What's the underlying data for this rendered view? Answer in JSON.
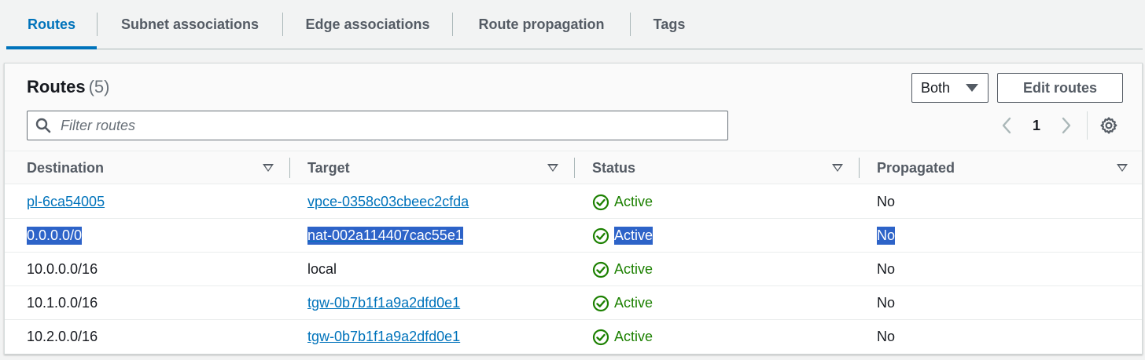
{
  "tabs": [
    {
      "label": "Routes",
      "active": true
    },
    {
      "label": "Subnet associations",
      "active": false
    },
    {
      "label": "Edge associations",
      "active": false
    },
    {
      "label": "Route propagation",
      "active": false
    },
    {
      "label": "Tags",
      "active": false
    }
  ],
  "panel": {
    "title": "Routes",
    "count": "(5)",
    "filter_select": "Both",
    "edit_button": "Edit routes",
    "search_placeholder": "Filter routes",
    "page_number": "1"
  },
  "table": {
    "columns": [
      "Destination",
      "Target",
      "Status",
      "Propagated"
    ],
    "rows": [
      {
        "destination": "pl-6ca54005",
        "destination_link": true,
        "target": "vpce-0358c03cbeec2cfda",
        "target_link": true,
        "status": "Active",
        "propagated": "No",
        "selected": false
      },
      {
        "destination": "0.0.0.0/0",
        "destination_link": false,
        "target": "nat-002a114407cac55e1",
        "target_link": true,
        "status": "Active",
        "propagated": "No",
        "selected": true
      },
      {
        "destination": "10.0.0.0/16",
        "destination_link": false,
        "target": "local",
        "target_link": false,
        "status": "Active",
        "propagated": "No",
        "selected": false
      },
      {
        "destination": "10.1.0.0/16",
        "destination_link": false,
        "target": "tgw-0b7b1f1a9a2dfd0e1",
        "target_link": true,
        "status": "Active",
        "propagated": "No",
        "selected": false
      },
      {
        "destination": "10.2.0.0/16",
        "destination_link": false,
        "target": "tgw-0b7b1f1a9a2dfd0e1",
        "target_link": true,
        "status": "Active",
        "propagated": "No",
        "selected": false
      }
    ]
  },
  "colors": {
    "accent": "#0073bb",
    "status_active": "#1d8102",
    "selection": "#2d63c8"
  },
  "icons": {
    "search": "search-icon",
    "pager_prev": "chevron-left-icon",
    "pager_next": "chevron-right-icon",
    "settings": "gear-icon",
    "status": "check-circle-icon",
    "sort": "caret-down-icon"
  }
}
